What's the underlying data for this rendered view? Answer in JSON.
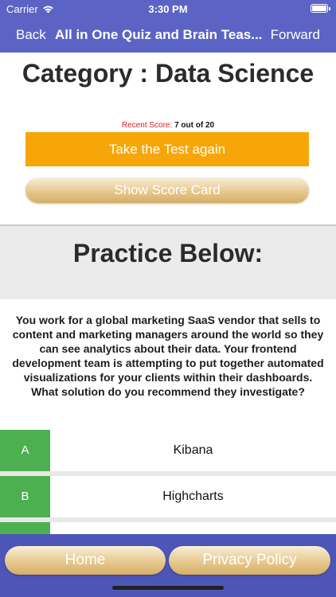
{
  "status_bar": {
    "carrier": "Carrier",
    "time": "3:30 PM",
    "wifi_icon": "wifi-icon",
    "battery_icon": "battery-icon"
  },
  "nav": {
    "back": "Back",
    "title": "All in One Quiz and Brain Teas...",
    "forward": "Forward"
  },
  "header": {
    "category_title": "Category : Data Science",
    "recent_score_label": "Recent Score:",
    "recent_score_value": "7 out of 20",
    "retake_button": "Take the Test again",
    "score_card_button": "Show Score Card"
  },
  "practice": {
    "title": "Practice Below:",
    "question": "You work for a global marketing SaaS vendor that sells to content and marketing managers around the world so they can see analytics about their data. Your frontend development team is attempting to put together automated visualizations for your clients within their dashboards. What solution do you recommend they investigate?",
    "answers": [
      {
        "letter": "A",
        "text": "Kibana"
      },
      {
        "letter": "B",
        "text": "Highcharts"
      },
      {
        "letter": "",
        "text": ""
      }
    ]
  },
  "bottom_bar": {
    "home": "Home",
    "privacy": "Privacy Policy"
  },
  "colors": {
    "nav_bg": "#5b64c4",
    "bottom_bg": "#4d56b7",
    "retake_orange": "#f7a609",
    "answer_green": "#4caf50",
    "score_label_red": "#e0201f"
  }
}
